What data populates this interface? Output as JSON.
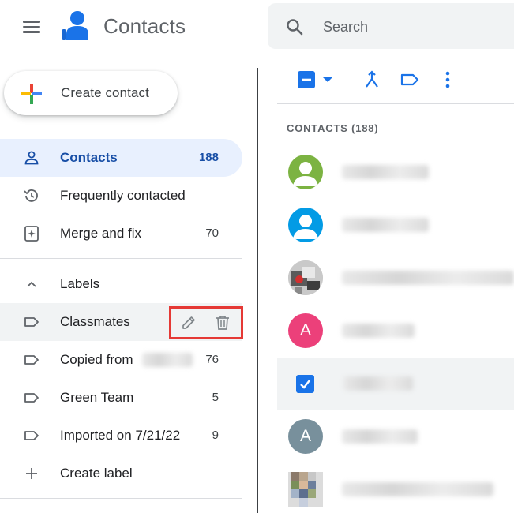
{
  "header": {
    "app_title": "Contacts",
    "search_placeholder": "Search"
  },
  "create": {
    "label": "Create contact"
  },
  "nav": {
    "contacts": {
      "label": "Contacts",
      "count": "188",
      "icon": "person-icon"
    },
    "frequent": {
      "label": "Frequently contacted",
      "icon": "history-icon"
    },
    "merge": {
      "label": "Merge and fix",
      "count": "70",
      "icon": "merge-fix-icon"
    }
  },
  "labels": {
    "heading": "Labels",
    "items": [
      {
        "label": "Classmates",
        "count": ""
      },
      {
        "label": "Copied from",
        "count": "76"
      },
      {
        "label": "Green Team",
        "count": "5"
      },
      {
        "label": "Imported on 7/21/22",
        "count": "9"
      }
    ],
    "create": "Create label"
  },
  "list": {
    "header": "CONTACTS (188)",
    "avatars": [
      {
        "type": "silhouette",
        "color": "#7cb342"
      },
      {
        "type": "silhouette",
        "color": "#039be5"
      },
      {
        "type": "photo",
        "color": "#9e9e9e"
      },
      {
        "type": "letter",
        "letter": "A",
        "color": "#ec407a"
      },
      {
        "type": "checkbox",
        "color": "#1a73e8"
      },
      {
        "type": "letter",
        "letter": "A",
        "color": "#78909c"
      },
      {
        "type": "photo",
        "color": "#8d9e7a"
      }
    ]
  },
  "colors": {
    "accent": "#1a73e8",
    "active_bg": "#e8f0fe",
    "active_text": "#174ea6",
    "highlight_frame": "#e53935"
  }
}
